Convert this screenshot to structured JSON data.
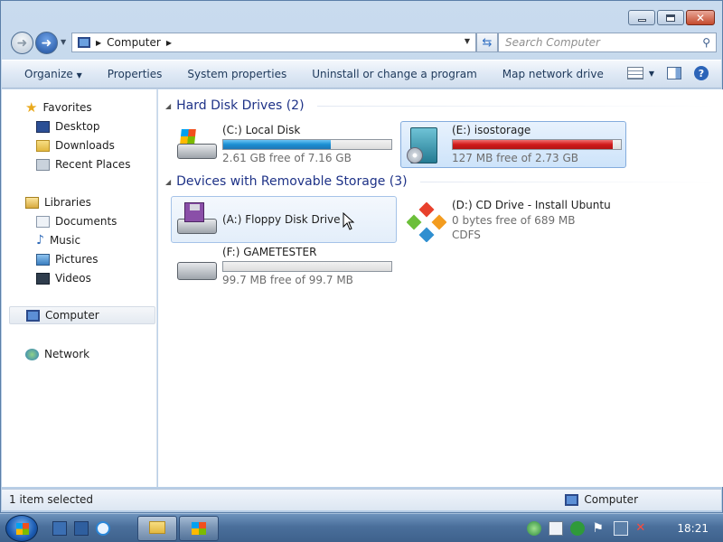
{
  "address": {
    "crumb": "Computer"
  },
  "search": {
    "placeholder": "Search Computer"
  },
  "toolbar": {
    "organize": "Organize",
    "properties": "Properties",
    "system_properties": "System properties",
    "uninstall": "Uninstall or change a program",
    "map_drive": "Map network drive",
    "more": "»"
  },
  "sidebar": {
    "favorites": "Favorites",
    "desktop": "Desktop",
    "downloads": "Downloads",
    "recent": "Recent Places",
    "libraries": "Libraries",
    "documents": "Documents",
    "music": "Music",
    "pictures": "Pictures",
    "videos": "Videos",
    "computer": "Computer",
    "network": "Network"
  },
  "groups": {
    "hdd": "Hard Disk Drives (2)",
    "removable": "Devices with Removable Storage (3)"
  },
  "drives": {
    "c": {
      "name": "(C:) Local Disk",
      "free": "2.61 GB free of 7.16 GB",
      "used_fraction": 0.64
    },
    "e": {
      "name": "(E:) isostorage",
      "free": "127 MB free of 2.73 GB",
      "used_fraction": 0.95
    },
    "a": {
      "name": "(A:) Floppy Disk Drive"
    },
    "d": {
      "name": "(D:) CD Drive - Install Ubuntu",
      "free": "0 bytes free of 689 MB",
      "fs": "CDFS"
    },
    "f": {
      "name": "(F:) GAMETESTER",
      "free": "99.7 MB free of 99.7 MB",
      "used_fraction": 0.0
    }
  },
  "status": {
    "left": "1 item selected",
    "right": "Computer"
  },
  "taskbar": {
    "clock": "18:21"
  },
  "colors": {
    "bar_blue": "#1a8fd3",
    "bar_red": "#d11a1a",
    "group_heading": "#1e3287"
  }
}
